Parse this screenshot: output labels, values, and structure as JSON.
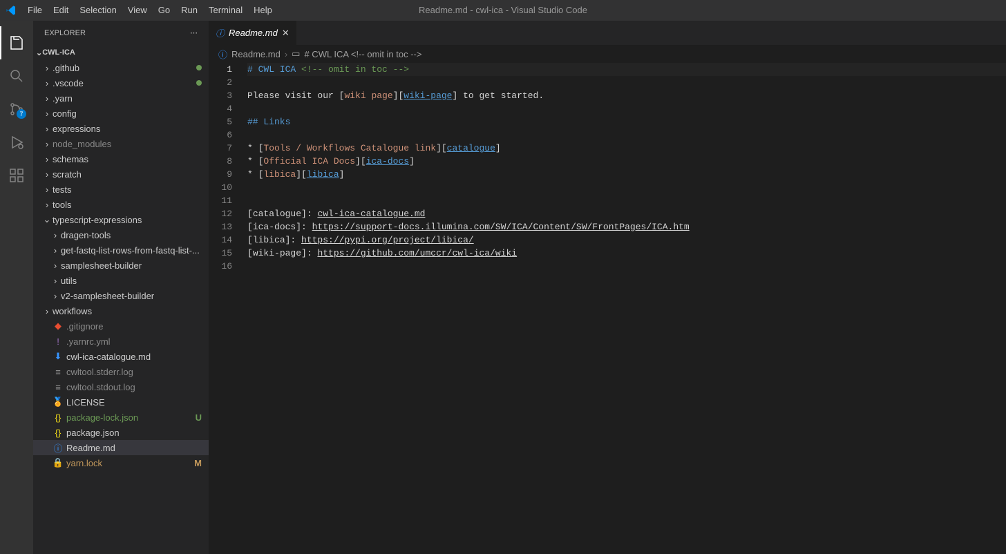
{
  "title": "Readme.md - cwl-ica - Visual Studio Code",
  "menu": [
    "File",
    "Edit",
    "Selection",
    "View",
    "Go",
    "Run",
    "Terminal",
    "Help"
  ],
  "activity": {
    "scm_badge": "7"
  },
  "sidebar": {
    "header": "EXPLORER",
    "project": "CWL-ICA",
    "tree": [
      {
        "type": "folder",
        "label": ".github",
        "depth": 1,
        "status": "dot"
      },
      {
        "type": "folder",
        "label": ".vscode",
        "depth": 1,
        "status": "dot"
      },
      {
        "type": "folder",
        "label": ".yarn",
        "depth": 1
      },
      {
        "type": "folder",
        "label": "config",
        "depth": 1
      },
      {
        "type": "folder",
        "label": "expressions",
        "depth": 1
      },
      {
        "type": "folder",
        "label": "node_modules",
        "depth": 1,
        "dim": true
      },
      {
        "type": "folder",
        "label": "schemas",
        "depth": 1
      },
      {
        "type": "folder",
        "label": "scratch",
        "depth": 1
      },
      {
        "type": "folder",
        "label": "tests",
        "depth": 1
      },
      {
        "type": "folder",
        "label": "tools",
        "depth": 1
      },
      {
        "type": "folder",
        "label": "typescript-expressions",
        "depth": 1,
        "open": true
      },
      {
        "type": "folder",
        "label": "dragen-tools",
        "depth": 2
      },
      {
        "type": "folder",
        "label": "get-fastq-list-rows-from-fastq-list-...",
        "depth": 2
      },
      {
        "type": "folder",
        "label": "samplesheet-builder",
        "depth": 2
      },
      {
        "type": "folder",
        "label": "utils",
        "depth": 2
      },
      {
        "type": "folder",
        "label": "v2-samplesheet-builder",
        "depth": 2
      },
      {
        "type": "folder",
        "label": "workflows",
        "depth": 1
      },
      {
        "type": "file",
        "label": ".gitignore",
        "depth": 1,
        "icon": "git",
        "dim": true
      },
      {
        "type": "file",
        "label": ".yarnrc.yml",
        "depth": 1,
        "icon": "yaml",
        "dim": true
      },
      {
        "type": "file",
        "label": "cwl-ica-catalogue.md",
        "depth": 1,
        "icon": "md"
      },
      {
        "type": "file",
        "label": "cwltool.stderr.log",
        "depth": 1,
        "icon": "log",
        "dim": true
      },
      {
        "type": "file",
        "label": "cwltool.stdout.log",
        "depth": 1,
        "icon": "log",
        "dim": true
      },
      {
        "type": "file",
        "label": "LICENSE",
        "depth": 1,
        "icon": "lic"
      },
      {
        "type": "file",
        "label": "package-lock.json",
        "depth": 1,
        "icon": "json",
        "git": "U"
      },
      {
        "type": "file",
        "label": "package.json",
        "depth": 1,
        "icon": "json"
      },
      {
        "type": "file",
        "label": "Readme.md",
        "depth": 1,
        "icon": "info",
        "selected": true
      },
      {
        "type": "file",
        "label": "yarn.lock",
        "depth": 1,
        "icon": "lock",
        "git": "M"
      }
    ]
  },
  "tab": {
    "label": "Readme.md"
  },
  "breadcrumb": {
    "file": "Readme.md",
    "symbol": "# CWL ICA <!-- omit in toc -->"
  },
  "editor": {
    "lines": [
      {
        "n": 1,
        "current": true,
        "segments": [
          [
            "hash",
            "# CWL ICA "
          ],
          [
            "comment",
            "<!-- omit in toc -->"
          ]
        ]
      },
      {
        "n": 2,
        "segments": []
      },
      {
        "n": 3,
        "segments": [
          [
            "text",
            "Please visit our "
          ],
          [
            "bracket",
            "["
          ],
          [
            "linktext",
            "wiki page"
          ],
          [
            "bracket",
            "]["
          ],
          [
            "linkref",
            "wiki-page"
          ],
          [
            "bracket",
            "]"
          ],
          [
            "text",
            " to get started."
          ]
        ]
      },
      {
        "n": 4,
        "segments": []
      },
      {
        "n": 5,
        "segments": [
          [
            "hash",
            "## Links"
          ]
        ]
      },
      {
        "n": 6,
        "segments": []
      },
      {
        "n": 7,
        "segments": [
          [
            "text",
            "* "
          ],
          [
            "bracket",
            "["
          ],
          [
            "linktext",
            "Tools / Workflows Catalogue link"
          ],
          [
            "bracket",
            "]["
          ],
          [
            "linkref",
            "catalogue"
          ],
          [
            "bracket",
            "]"
          ]
        ]
      },
      {
        "n": 8,
        "segments": [
          [
            "text",
            "* "
          ],
          [
            "bracket",
            "["
          ],
          [
            "linktext",
            "Official ICA Docs"
          ],
          [
            "bracket",
            "]["
          ],
          [
            "linkref",
            "ica-docs"
          ],
          [
            "bracket",
            "]"
          ]
        ]
      },
      {
        "n": 9,
        "segments": [
          [
            "text",
            "* "
          ],
          [
            "bracket",
            "["
          ],
          [
            "linktext",
            "libica"
          ],
          [
            "bracket",
            "]["
          ],
          [
            "linkref",
            "libica"
          ],
          [
            "bracket",
            "]"
          ]
        ]
      },
      {
        "n": 10,
        "segments": []
      },
      {
        "n": 11,
        "segments": []
      },
      {
        "n": 12,
        "segments": [
          [
            "bracket",
            "["
          ],
          [
            "text",
            "catalogue"
          ],
          [
            "bracket",
            "]: "
          ],
          [
            "url",
            "cwl-ica-catalogue.md"
          ]
        ]
      },
      {
        "n": 13,
        "segments": [
          [
            "bracket",
            "["
          ],
          [
            "text",
            "ica-docs"
          ],
          [
            "bracket",
            "]: "
          ],
          [
            "url",
            "https://support-docs.illumina.com/SW/ICA/Content/SW/FrontPages/ICA.htm"
          ]
        ]
      },
      {
        "n": 14,
        "segments": [
          [
            "bracket",
            "["
          ],
          [
            "text",
            "libica"
          ],
          [
            "bracket",
            "]: "
          ],
          [
            "url",
            "https://pypi.org/project/libica/"
          ]
        ]
      },
      {
        "n": 15,
        "segments": [
          [
            "bracket",
            "["
          ],
          [
            "text",
            "wiki-page"
          ],
          [
            "bracket",
            "]: "
          ],
          [
            "url",
            "https://github.com/umccr/cwl-ica/wiki"
          ]
        ]
      },
      {
        "n": 16,
        "segments": []
      }
    ]
  }
}
